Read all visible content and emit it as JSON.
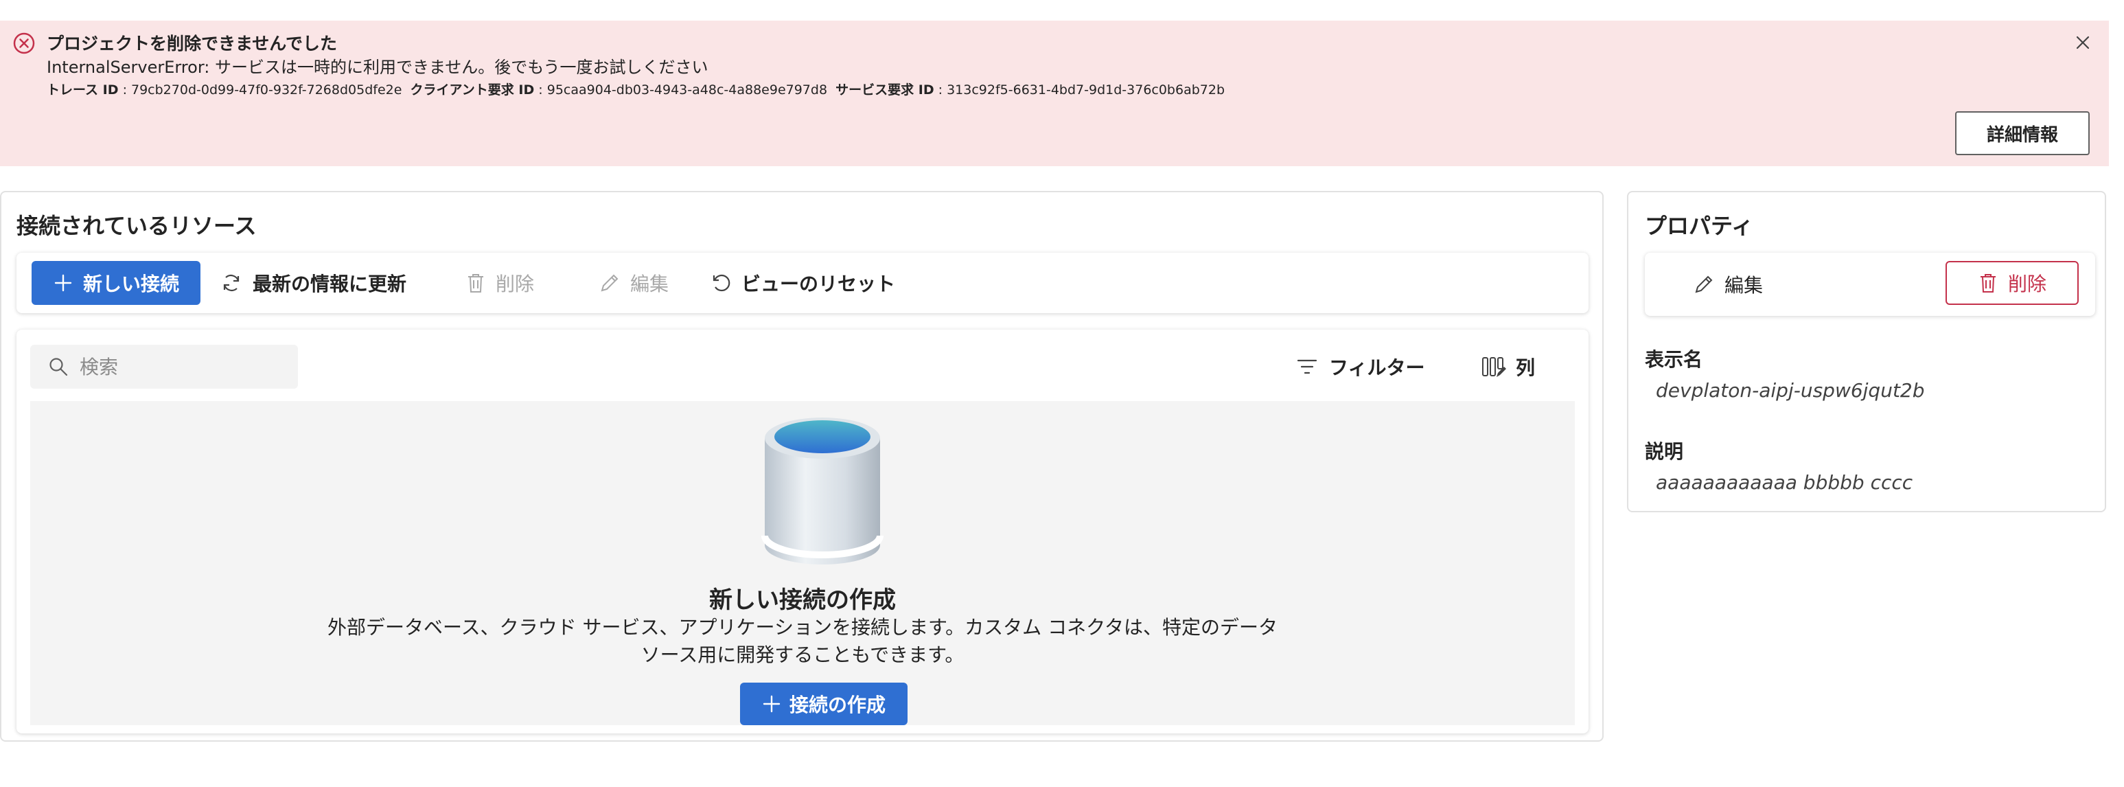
{
  "error_banner": {
    "title": "プロジェクトを削除できませんでした",
    "message": "InternalServerError: サービスは一時的に利用できません。後でもう一度お試しください",
    "trace_id_label": "トレース ID",
    "trace_id_value": ": 79cb270d-0d99-47f0-932f-7268d05dfe2e",
    "client_request_id_label": "クライアント要求 ID",
    "client_request_id_value": ": 95caa904-db03-4943-a48c-4a88e9e797d8",
    "service_request_id_label": "サービス要求 ID",
    "service_request_id_value": ": 313c92f5-6631-4bd7-9d1d-376c0b6ab72b",
    "details_button": "詳細情報",
    "color": "#fae5e6",
    "icon_color": "#c4314b"
  },
  "connected_resources": {
    "title": "接続されているリソース",
    "toolbar": {
      "new_connection": "新しい接続",
      "refresh": "最新の情報に更新",
      "delete": "削除",
      "edit": "編集",
      "reset_view": "ビューのリセット"
    },
    "search": {
      "placeholder": "検索",
      "value": ""
    },
    "filter_label": "フィルター",
    "columns_label": "列",
    "empty_state": {
      "title": "新しい接続の作成",
      "description": "外部データベース、クラウド サービス、アプリケーションを接続します。カスタム コネクタは、特定のデータソース用に開発することもできます。",
      "button": "接続の作成"
    }
  },
  "properties": {
    "title": "プロパティ",
    "edit": "編集",
    "delete": "削除",
    "display_name_label": "表示名",
    "display_name_value": "devplaton-aipj-uspw6jqut2b",
    "description_label": "説明",
    "description_value": "aaaaaaaaaaaa bbbbb cccc"
  },
  "colors": {
    "primary": "#2f6fd2",
    "danger": "#c4314b",
    "disabled": "#a8a8a8"
  }
}
